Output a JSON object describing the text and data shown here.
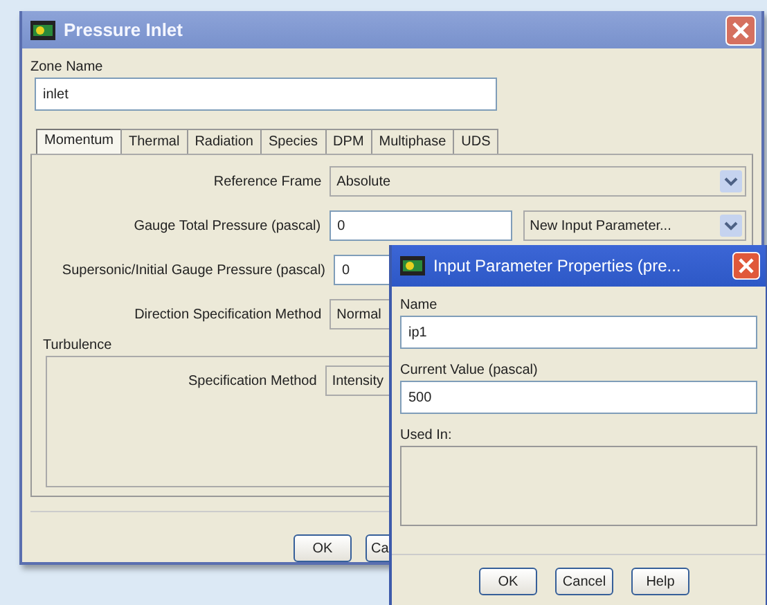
{
  "window": {
    "title": "Pressure Inlet"
  },
  "zone_name": {
    "label": "Zone Name",
    "value": "inlet"
  },
  "tabs": [
    {
      "label": "Momentum",
      "selected": true
    },
    {
      "label": "Thermal",
      "selected": false
    },
    {
      "label": "Radiation",
      "selected": false
    },
    {
      "label": "Species",
      "selected": false
    },
    {
      "label": "DPM",
      "selected": false
    },
    {
      "label": "Multiphase",
      "selected": false
    },
    {
      "label": "UDS",
      "selected": false
    }
  ],
  "momentum": [
    {
      "kind": "dropdown",
      "label": "Reference Frame",
      "value": "Absolute"
    },
    {
      "kind": "field-dropdown",
      "label": "Gauge Total Pressure (pascal)",
      "value": "0",
      "option": "New Input Parameter..."
    },
    {
      "kind": "field",
      "label": "Supersonic/Initial Gauge Pressure (pascal)",
      "value": "0"
    },
    {
      "kind": "cut-dropdown",
      "label": "Direction Specification Method",
      "value": "Normal"
    }
  ],
  "turbulence": {
    "title": "Turbulence",
    "label": "Specification Method",
    "value": "Intensity"
  },
  "buttons": [
    "OK",
    "Ca"
  ],
  "dialog": {
    "title": "Input Parameter Properties (pre...",
    "name_label": "Name",
    "name_value": "ip1",
    "value_label": "Current Value (pascal)",
    "value": "500",
    "used_in_label": "Used In:",
    "buttons": [
      "OK",
      "Cancel",
      "Help"
    ]
  }
}
